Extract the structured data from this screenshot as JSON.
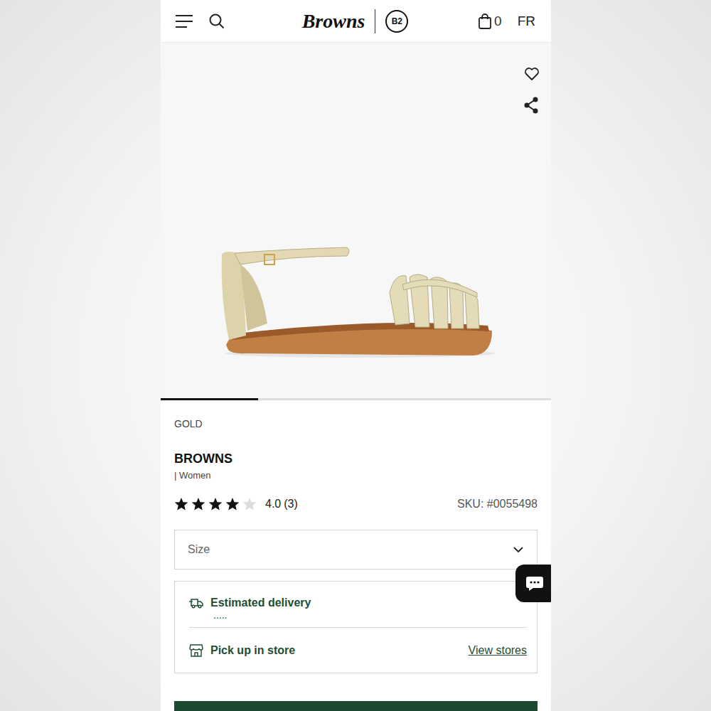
{
  "header": {
    "logo": "Browns",
    "sub_logo": "B2",
    "cart_count": "0",
    "language": "FR"
  },
  "gallery": {
    "level": 0.25
  },
  "product": {
    "color": "GOLD",
    "brand": "BROWNS",
    "category": "| Women",
    "stars": 4,
    "rating": "4.0",
    "reviews": "(3)",
    "sku": "SKU: #0055498"
  },
  "size_select": {
    "placeholder": "Size"
  },
  "delivery": {
    "title": "Estimated delivery",
    "value": "....."
  },
  "pickup": {
    "title": "Pick up in store",
    "link": "View stores"
  }
}
